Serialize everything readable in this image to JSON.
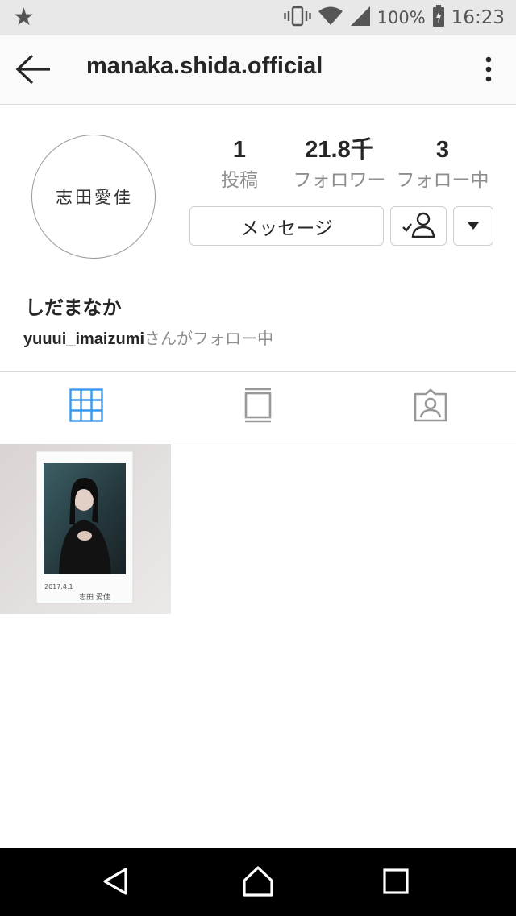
{
  "status_bar": {
    "battery": "100%",
    "time": "16:23"
  },
  "header": {
    "username": "manaka.shida.official"
  },
  "profile": {
    "avatar_text": "志田愛佳",
    "stats": [
      {
        "value": "1",
        "label": "投稿"
      },
      {
        "value": "21.8千",
        "label": "フォロワー"
      },
      {
        "value": "3",
        "label": "フォロー中"
      }
    ],
    "message_button": "メッセージ",
    "display_name": "しだまなか",
    "followed_by_user": "yuuui_imaizumi",
    "followed_by_suffix": "さんがフォロー中"
  },
  "posts": [
    {
      "caption_date": "2017.4.1",
      "caption_name": "志田 愛佳"
    }
  ],
  "colors": {
    "active_tab": "#3897f0",
    "inactive_icon": "#999999",
    "muted_text": "#8e8e8e"
  },
  "icons": [
    "star-icon",
    "vibrate-icon",
    "wifi-icon",
    "signal-icon",
    "battery-icon",
    "back-arrow-icon",
    "more-vertical-icon",
    "follow-check-icon",
    "dropdown-arrow-icon",
    "grid-icon",
    "list-icon",
    "tagged-icon",
    "nav-back-icon",
    "nav-home-icon",
    "nav-recents-icon"
  ]
}
